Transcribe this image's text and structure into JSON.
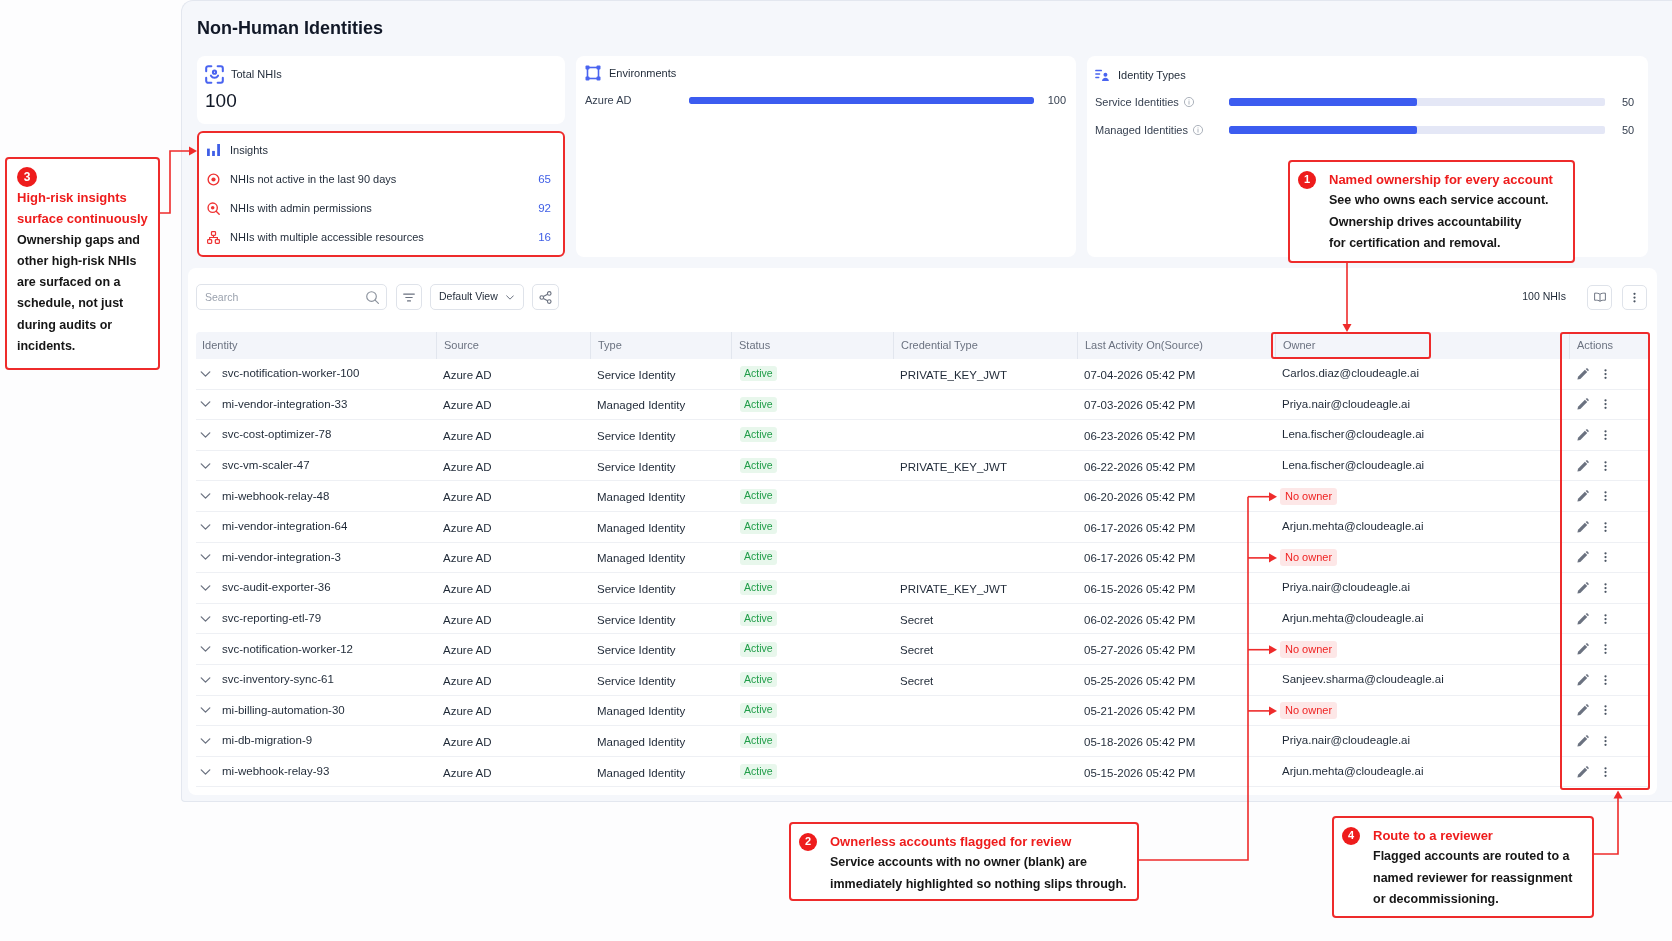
{
  "page": {
    "title": "Non-Human Identities"
  },
  "summary": {
    "total": {
      "label": "Total NHIs",
      "value": "100"
    },
    "insights": {
      "title": "Insights",
      "highlighted": true,
      "items": [
        {
          "kind": "inactive",
          "label": "NHIs not active in the last 90 days",
          "count": "65"
        },
        {
          "kind": "admin",
          "label": "NHIs with admin permissions",
          "count": "92"
        },
        {
          "kind": "resources",
          "label": "NHIs with multiple accessible resources",
          "count": "16"
        }
      ]
    },
    "environments": {
      "title": "Environments",
      "items": [
        {
          "label": "Azure AD",
          "level": 1,
          "count": "100"
        }
      ]
    },
    "identity_types": {
      "title": "Identity Types",
      "items": [
        {
          "label": "Service Identities",
          "level": 0.5,
          "count": "50"
        },
        {
          "label": "Managed Identities",
          "level": 0.5,
          "count": "50"
        }
      ]
    }
  },
  "toolbar": {
    "search": {
      "placeholder": "Search"
    },
    "view": "Default View",
    "count": "100 NHIs"
  },
  "table": {
    "columns": [
      {
        "label": "Identity",
        "header_highlighted": false,
        "column_highlighted": false
      },
      {
        "label": "Source",
        "header_highlighted": false,
        "column_highlighted": false
      },
      {
        "label": "Type",
        "header_highlighted": false,
        "column_highlighted": false
      },
      {
        "label": "Status",
        "header_highlighted": false,
        "column_highlighted": false
      },
      {
        "label": "Credential Type",
        "header_highlighted": false,
        "column_highlighted": false
      },
      {
        "label": "Last Activity On(Source)",
        "header_highlighted": false,
        "column_highlighted": false
      },
      {
        "label": "Owner",
        "header_highlighted": true,
        "column_highlighted": false
      },
      {
        "label": "Actions",
        "header_highlighted": false,
        "column_highlighted": true
      }
    ],
    "rows": [
      {
        "identity": "svc-notification-worker-100",
        "source": "Azure AD",
        "type": "Service Identity",
        "status": "Active",
        "credential_type": "PRIVATE_KEY_JWT",
        "last_activity": "07-04-2026 05:42 PM",
        "owner": "Carlos.diaz@cloudeagle.ai",
        "flagged": false
      },
      {
        "identity": "mi-vendor-integration-33",
        "source": "Azure AD",
        "type": "Managed Identity",
        "status": "Active",
        "last_activity": "07-03-2026 05:42 PM",
        "owner": "Priya.nair@cloudeagle.ai",
        "flagged": false
      },
      {
        "identity": "svc-cost-optimizer-78",
        "source": "Azure AD",
        "type": "Service Identity",
        "status": "Active",
        "last_activity": "06-23-2026 05:42 PM",
        "owner": "Lena.fischer@cloudeagle.ai",
        "flagged": false
      },
      {
        "identity": "svc-vm-scaler-47",
        "source": "Azure AD",
        "type": "Service Identity",
        "status": "Active",
        "credential_type": "PRIVATE_KEY_JWT",
        "last_activity": "06-22-2026 05:42 PM",
        "owner": "Lena.fischer@cloudeagle.ai",
        "flagged": false
      },
      {
        "identity": "mi-webhook-relay-48",
        "source": "Azure AD",
        "type": "Managed Identity",
        "status": "Active",
        "last_activity": "06-20-2026 05:42 PM",
        "owner": "No owner",
        "flagged": true
      },
      {
        "identity": "mi-vendor-integration-64",
        "source": "Azure AD",
        "type": "Managed Identity",
        "status": "Active",
        "last_activity": "06-17-2026 05:42 PM",
        "owner": "Arjun.mehta@cloudeagle.ai",
        "flagged": false
      },
      {
        "identity": "mi-vendor-integration-3",
        "source": "Azure AD",
        "type": "Managed Identity",
        "status": "Active",
        "last_activity": "06-17-2026 05:42 PM",
        "owner": "No owner",
        "flagged": true
      },
      {
        "identity": "svc-audit-exporter-36",
        "source": "Azure AD",
        "type": "Service Identity",
        "status": "Active",
        "credential_type": "PRIVATE_KEY_JWT",
        "last_activity": "06-15-2026 05:42 PM",
        "owner": "Priya.nair@cloudeagle.ai",
        "flagged": false
      },
      {
        "identity": "svc-reporting-etl-79",
        "source": "Azure AD",
        "type": "Service Identity",
        "status": "Active",
        "credential_type": "Secret",
        "last_activity": "06-02-2026 05:42 PM",
        "owner": "Arjun.mehta@cloudeagle.ai",
        "flagged": false
      },
      {
        "identity": "svc-notification-worker-12",
        "source": "Azure AD",
        "type": "Service Identity",
        "status": "Active",
        "credential_type": "Secret",
        "last_activity": "05-27-2026 05:42 PM",
        "owner": "No owner",
        "flagged": true
      },
      {
        "identity": "svc-inventory-sync-61",
        "source": "Azure AD",
        "type": "Service Identity",
        "status": "Active",
        "credential_type": "Secret",
        "last_activity": "05-25-2026 05:42 PM",
        "owner": "Sanjeev.sharma@cloudeagle.ai",
        "flagged": false
      },
      {
        "identity": "mi-billing-automation-30",
        "source": "Azure AD",
        "type": "Managed Identity",
        "status": "Active",
        "last_activity": "05-21-2026 05:42 PM",
        "owner": "No owner",
        "flagged": true
      },
      {
        "identity": "mi-db-migration-9",
        "source": "Azure AD",
        "type": "Managed Identity",
        "status": "Active",
        "last_activity": "05-18-2026 05:42 PM",
        "owner": "Priya.nair@cloudeagle.ai",
        "flagged": false
      },
      {
        "identity": "mi-webhook-relay-93",
        "source": "Azure AD",
        "type": "Managed Identity",
        "status": "Active",
        "last_activity": "05-15-2026 05:42 PM",
        "owner": "Arjun.mehta@cloudeagle.ai",
        "flagged": false
      }
    ]
  },
  "callouts": [
    {
      "number": "1",
      "title": "Named ownership for every account",
      "text": "See who owns each service account.\nOwnership drives accountability\nfor certification and removal."
    },
    {
      "number": "2",
      "title": "Ownerless accounts flagged for review",
      "text": "Service accounts with no owner (blank) are\nimmediately highlighted so nothing slips through."
    },
    {
      "number": "3",
      "title": "High-risk insights\nsurface continuously",
      "text": "Ownership gaps and\nother high-risk NHIs\nare surfaced on a\nschedule, not just\nduring audits or\nincidents."
    },
    {
      "number": "4",
      "title": "Route to a reviewer",
      "text": "Flagged accounts are routed to a\nnamed reviewer for reassignment\nor decommissioning."
    }
  ]
}
